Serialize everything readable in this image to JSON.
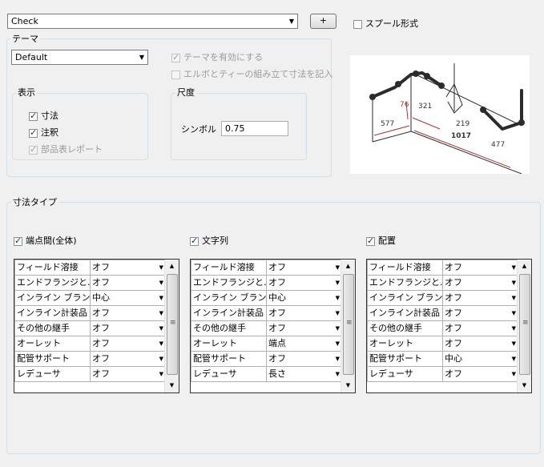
{
  "top": {
    "name_value": "Check",
    "add_button_label": "+",
    "spool_label": "スプール形式",
    "spool_checked": false
  },
  "theme": {
    "group_title": "テーマ",
    "selected": "Default",
    "enable_label": "テーマを有効にする",
    "elbow_tee_label": "エルボとティーの組み立て寸法を記入"
  },
  "display": {
    "group_title": "表示",
    "items": [
      {
        "label": "寸法",
        "checked": true,
        "enabled": true
      },
      {
        "label": "注釈",
        "checked": true,
        "enabled": true
      },
      {
        "label": "部品表レポート",
        "checked": true,
        "enabled": false
      }
    ]
  },
  "scale": {
    "group_title": "尺度",
    "symbol_label": "シンボル",
    "symbol_value": "0.75"
  },
  "preview": {
    "dims": [
      "76",
      "321",
      "577",
      "219",
      "1017",
      "477"
    ]
  },
  "dim_type": {
    "group_title": "寸法タイプ",
    "columns": [
      {
        "title": "端点間(全体)",
        "checked": true,
        "rows": [
          [
            "フィールド溶接",
            "オフ"
          ],
          [
            "エンドフランジと…",
            "オフ"
          ],
          [
            "インライン ブランチ",
            "中心"
          ],
          [
            "インライン計装品",
            "オフ"
          ],
          [
            "その他の継手",
            "オフ"
          ],
          [
            "オーレット",
            "オフ"
          ],
          [
            "配管サポート",
            "オフ"
          ],
          [
            "レデューサ",
            "オフ"
          ]
        ]
      },
      {
        "title": "文字列",
        "checked": true,
        "rows": [
          [
            "フィールド溶接",
            "オフ"
          ],
          [
            "エンドフランジと…",
            "オフ"
          ],
          [
            "インライン ブランチ",
            "中心"
          ],
          [
            "インライン計装品",
            "オフ"
          ],
          [
            "その他の継手",
            "オフ"
          ],
          [
            "オーレット",
            "端点"
          ],
          [
            "配管サポート",
            "オフ"
          ],
          [
            "レデューサ",
            "長さ"
          ]
        ]
      },
      {
        "title": "配置",
        "checked": true,
        "rows": [
          [
            "フィールド溶接",
            "オフ"
          ],
          [
            "エンドフランジと…",
            "オフ"
          ],
          [
            "インライン ブランチ",
            "オフ"
          ],
          [
            "インライン計装品",
            "オフ"
          ],
          [
            "その他の継手",
            "オフ"
          ],
          [
            "オーレット",
            "オフ"
          ],
          [
            "配管サポート",
            "中心"
          ],
          [
            "レデューサ",
            "オフ"
          ]
        ]
      }
    ]
  }
}
